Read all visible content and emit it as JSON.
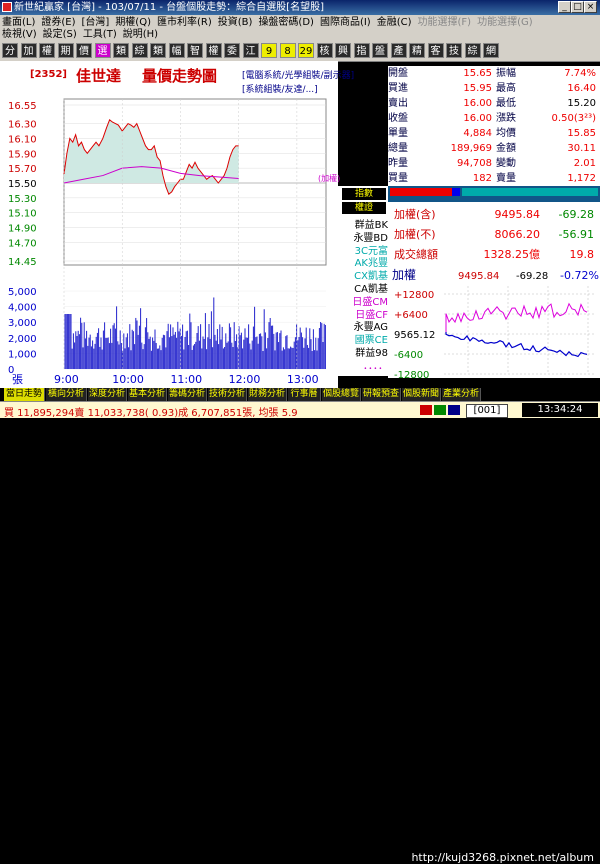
{
  "window": {
    "title": "新世紀贏家 [台灣] - 103/07/11 - 台盤個股走勢：綜合自選股[名望股]"
  },
  "menu": {
    "row1": [
      "畫面(L)",
      "證券(E)",
      "[台灣]",
      "期權(Q)",
      "匯市利率(R)",
      "投資(B)",
      "操盤密碼(D)",
      "國際商品(I)",
      "金融(C)",
      "功能選擇(F)",
      "功能選擇(G)"
    ],
    "row2": [
      "檢視(V)",
      "設定(S)",
      "工具(T)",
      "說明(H)"
    ]
  },
  "categories": [
    "分",
    "加",
    "權",
    "期",
    "價",
    "選",
    "類",
    "綜",
    "類",
    "幅",
    "智",
    "權",
    "委",
    "江",
    "9",
    "8",
    "29",
    "核",
    "興",
    "指",
    "盤",
    "產",
    "精",
    "客",
    "技",
    "綜",
    "網"
  ],
  "stock": {
    "code": "[2352]",
    "name": "佳世達",
    "chart_title": "量價走勢圖"
  },
  "tags": [
    "[電腦系統/光學組裝/副示器]",
    "[系統組裝/友達/...]",
    "(加權)"
  ],
  "quote": {
    "rows": [
      {
        "l1": "開盤",
        "v1": "15.65",
        "c1": "red",
        "l2": "振幅",
        "v2": "7.74%",
        "c2": "red"
      },
      {
        "l1": "買進",
        "v1": "15.95",
        "c1": "red",
        "l2": "最高",
        "v2": "16.40",
        "c2": "red"
      },
      {
        "l1": "賣出",
        "v1": "16.00",
        "c1": "red",
        "l2": "最低",
        "v2": "15.20",
        "c2": "blk"
      },
      {
        "l1": "收盤",
        "v1": "16.00",
        "c1": "red",
        "l2": "漲跌",
        "v2": "0.50(3²³)",
        "c2": "red"
      },
      {
        "l1": "單量",
        "v1": "4,884",
        "c1": "red",
        "l2": "均價",
        "v2": "15.85",
        "c2": "red"
      },
      {
        "l1": "總量",
        "v1": "189,969",
        "c1": "red",
        "l2": "金額",
        "v2": "30.11",
        "c2": "red"
      },
      {
        "l1": "昨量",
        "v1": "94,708",
        "c1": "red",
        "l2": "變動",
        "v2": "2.01",
        "c2": "red"
      },
      {
        "l1": "買量",
        "v1": "182",
        "c1": "red",
        "l2": "賣量",
        "v2": "1,172",
        "c2": "red"
      }
    ]
  },
  "brokers": {
    "header1": "指數",
    "header2": "權證",
    "items": [
      {
        "name": "群益BK",
        "color": "#000000"
      },
      {
        "name": "永豐BD",
        "color": "#000000"
      },
      {
        "name": "3C元富",
        "color": "#00aaaa"
      },
      {
        "name": "AK兆豐",
        "color": "#00aaaa"
      },
      {
        "name": "CX凱基",
        "color": "#00aaaa"
      },
      {
        "name": "CA凱基",
        "color": "#000000"
      },
      {
        "name": "日盛CM",
        "color": "#cc00cc"
      },
      {
        "name": "日盛CF",
        "color": "#cc00cc"
      },
      {
        "name": "永豐AG",
        "color": "#000000"
      },
      {
        "name": "國票CE",
        "color": "#00aaaa"
      },
      {
        "name": "群益98",
        "color": "#000000"
      },
      {
        "name": "．．．．",
        "color": "#cc00cc"
      }
    ]
  },
  "summary": {
    "rows": [
      {
        "label": "加權(含)",
        "value": "9495.84",
        "change": "-69.28"
      },
      {
        "label": "加權(不)",
        "value": "8066.20",
        "change": "-56.91"
      },
      {
        "label": "成交總額",
        "value": "1328.25億",
        "change": "19.8"
      }
    ]
  },
  "mini": {
    "label": "加權",
    "value": "9495.84",
    "change": "-69.28",
    "pct": "-0.72%",
    "ticks": [
      "+12800",
      "+6400",
      "9565.12",
      "-6400",
      "-12800"
    ]
  },
  "bottom_tabs": [
    "當日走勢",
    "橫向分析",
    "深度分析",
    "基本分析",
    "籌碼分析",
    "技術分析",
    "財務分析",
    "行事曆",
    "個股總覽",
    "研報預查",
    "個股新聞",
    "產業分析"
  ],
  "ticker": {
    "text": "買 11,895,294賣 11,033,738( 0.93)成 6,707,851張, 均張 5.9",
    "code": "[001]",
    "clock": "13:34:24"
  },
  "watermark": "http://kujd3268.pixnet.net/album",
  "chart_data": {
    "type": "line",
    "price_ticks": [
      "16.55",
      "16.30",
      "16.10",
      "15.90",
      "15.70",
      "15.50",
      "15.30",
      "15.10",
      "14.90",
      "14.70",
      "14.45"
    ],
    "volume_ticks": [
      "5,000",
      "4,000",
      "3,000",
      "2,000",
      "1,000",
      "0"
    ],
    "volume_unit": "張",
    "x_ticks": [
      "9:00",
      "10:00",
      "11:00",
      "12:00",
      "13:00"
    ],
    "ylim": [
      14.45,
      16.55
    ],
    "reference": 15.5,
    "price": [
      [
        0,
        15.62
      ],
      [
        3,
        15.9
      ],
      [
        6,
        16.1
      ],
      [
        9,
        16.05
      ],
      [
        12,
        16.15
      ],
      [
        15,
        16.0
      ],
      [
        18,
        16.05
      ],
      [
        21,
        15.95
      ],
      [
        24,
        15.9
      ],
      [
        27,
        15.95
      ],
      [
        30,
        16.0
      ],
      [
        33,
        16.05
      ],
      [
        36,
        16.0
      ],
      [
        40,
        16.1
      ],
      [
        44,
        16.25
      ],
      [
        47,
        16.35
      ],
      [
        50,
        16.32
      ],
      [
        53,
        16.3
      ],
      [
        56,
        16.28
      ],
      [
        60,
        16.2
      ],
      [
        63,
        16.25
      ],
      [
        66,
        16.3
      ],
      [
        69,
        16.28
      ],
      [
        72,
        16.25
      ],
      [
        75,
        16.3
      ],
      [
        78,
        16.2
      ],
      [
        81,
        16.1
      ],
      [
        84,
        16.0
      ],
      [
        87,
        15.95
      ],
      [
        90,
        15.95
      ],
      [
        93,
        16.0
      ],
      [
        96,
        15.85
      ],
      [
        99,
        15.8
      ],
      [
        102,
        15.6
      ],
      [
        105,
        15.45
      ],
      [
        108,
        15.35
      ],
      [
        111,
        15.38
      ],
      [
        114,
        15.45
      ],
      [
        117,
        15.5
      ],
      [
        120,
        15.55
      ],
      [
        123,
        15.55
      ],
      [
        126,
        15.65
      ],
      [
        129,
        15.75
      ],
      [
        132,
        15.7
      ],
      [
        135,
        15.78
      ],
      [
        138,
        15.7
      ],
      [
        141,
        15.65
      ],
      [
        144,
        15.6
      ],
      [
        147,
        15.55
      ],
      [
        150,
        15.58
      ],
      [
        153,
        15.6
      ],
      [
        156,
        15.55
      ],
      [
        159,
        15.5
      ],
      [
        162,
        15.55
      ],
      [
        165,
        15.6
      ],
      [
        168,
        15.7
      ],
      [
        171,
        15.85
      ],
      [
        174,
        15.95
      ],
      [
        177,
        16.0
      ],
      [
        180,
        16.0
      ]
    ],
    "avg_price": [
      [
        0,
        15.5
      ],
      [
        20,
        15.55
      ],
      [
        40,
        15.6
      ],
      [
        60,
        15.7
      ],
      [
        80,
        15.72
      ],
      [
        100,
        15.7
      ],
      [
        120,
        15.63
      ],
      [
        140,
        15.6
      ],
      [
        160,
        15.58
      ],
      [
        180,
        15.56
      ]
    ]
  }
}
